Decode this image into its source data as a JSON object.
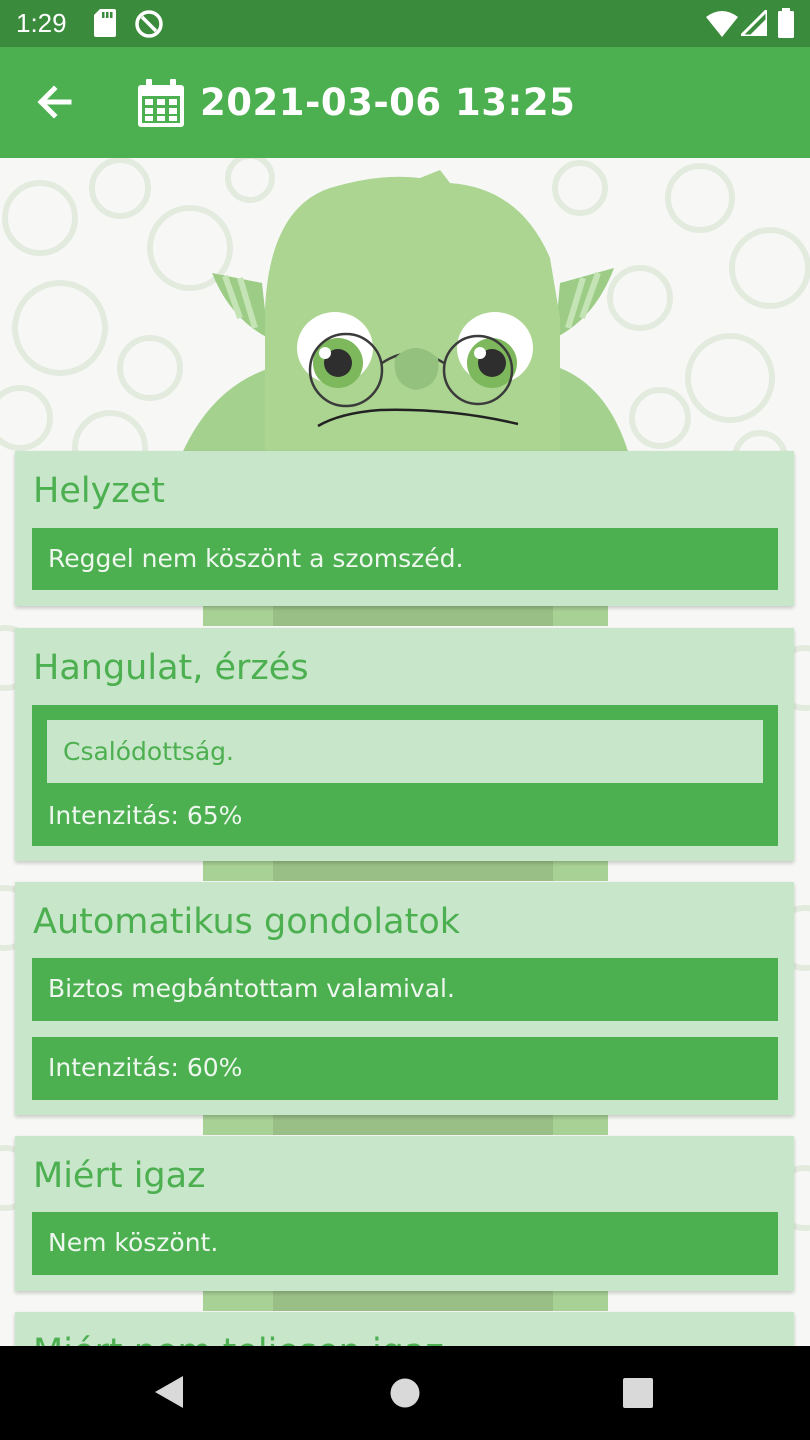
{
  "status_bar": {
    "time": "1:29",
    "icons": [
      "sd-card-icon",
      "at-sign-icon",
      "wifi-icon",
      "signal-icon",
      "battery-icon"
    ]
  },
  "app_bar": {
    "title": "2021-03-06 13:25",
    "back_icon": "arrow-left-icon",
    "date_icon": "calendar-icon"
  },
  "colors": {
    "primary": "#4caf50",
    "primary_dark": "#3a8b3c",
    "card_bg": "#c8e6c9"
  },
  "cards": {
    "situation": {
      "title": "Helyzet",
      "text": "Reggel nem köszönt a szomszéd."
    },
    "mood": {
      "title": "Hangulat, érzés",
      "emotion": "Csalódottság.",
      "intensity": "Intenzitás: 65%",
      "intensity_value": 65
    },
    "thoughts": {
      "title": "Automatikus gondolatok",
      "text": "Biztos megbántottam valamival.",
      "intensity": "Intenzitás: 60%",
      "intensity_value": 60
    },
    "why_true": {
      "title": "Miért igaz",
      "text": "Nem köszönt."
    },
    "why_not_true": {
      "title": "Miért nem teljesen igaz"
    }
  },
  "nav_bar": {
    "icons": [
      "back-triangle-icon",
      "home-circle-icon",
      "recents-square-icon"
    ]
  }
}
